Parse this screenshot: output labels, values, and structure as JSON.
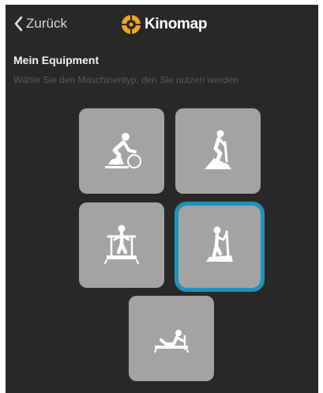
{
  "header": {
    "back_label": "Zurück",
    "brand_name": "Kinomap"
  },
  "equipment": {
    "title": "Mein Equipment",
    "subtitle": "Wähle Sie den Maschinentyp, den Sie nutzen werden",
    "selected_index": 3,
    "accent_color": "#1e93bd",
    "tiles": [
      {
        "icon": "bike-trainer-icon"
      },
      {
        "icon": "spin-bike-icon"
      },
      {
        "icon": "treadmill-icon"
      },
      {
        "icon": "elliptical-icon"
      },
      {
        "icon": "rowing-machine-icon"
      }
    ]
  }
}
